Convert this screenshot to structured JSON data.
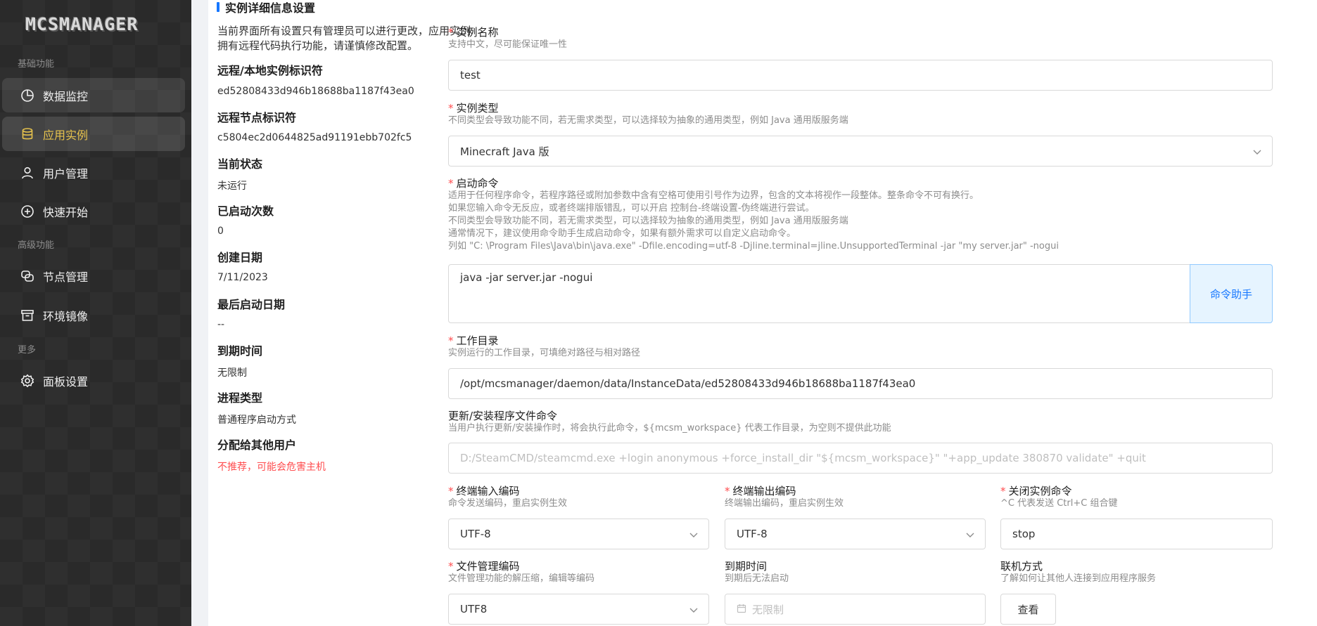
{
  "sidebar": {
    "logo": "MCSMANAGER",
    "sections": {
      "basic": "基础功能",
      "advanced": "高级功能",
      "more": "更多"
    },
    "items": [
      {
        "label": "数据监控",
        "icon": "dashboard-icon"
      },
      {
        "label": "应用实例",
        "icon": "database-icon"
      },
      {
        "label": "用户管理",
        "icon": "user-icon"
      },
      {
        "label": "快速开始",
        "icon": "plus-circle-icon"
      },
      {
        "label": "节点管理",
        "icon": "node-icon"
      },
      {
        "label": "环境镜像",
        "icon": "image-icon"
      },
      {
        "label": "面板设置",
        "icon": "gear-icon"
      }
    ],
    "accent": "#e7c34d"
  },
  "page": {
    "title": "实例详细信息设置",
    "notice": "当前界面所有设置只有管理员可以进行更改，应用实例拥有远程代码执行功能，请谨慎修改配置。",
    "info": [
      {
        "label": "远程/本地实例标识符",
        "value": "ed52808433d946b18688ba1187f43ea0"
      },
      {
        "label": "远程节点标识符",
        "value": "c5804ec2d0644825ad91191ebb702fc5"
      },
      {
        "label": "当前状态",
        "value": "未运行"
      },
      {
        "label": "已启动次数",
        "value": "0"
      },
      {
        "label": "创建日期",
        "value": "7/11/2023"
      },
      {
        "label": "最后启动日期",
        "value": "--"
      },
      {
        "label": "到期时间",
        "value": "无限制"
      },
      {
        "label": "进程类型",
        "value": "普通程序启动方式"
      },
      {
        "label": "分配给其他用户",
        "value": "不推荐，可能会危害主机"
      }
    ]
  },
  "form": {
    "name": {
      "label": "实例名称",
      "hint": "支持中文，尽可能保证唯一性",
      "value": "test"
    },
    "type": {
      "label": "实例类型",
      "hint": "不同类型会导致功能不同，若无需求类型，可以选择较为抽象的通用类型，例如 Java 通用版服务端",
      "value": "Minecraft Java 版"
    },
    "command": {
      "label": "启动命令",
      "hints": [
        "适用于任何程序命令，若程序路径或附加参数中含有空格可使用引号作为边界，包含的文本将视作一段整体。整条命令不可有换行。",
        "如果您输入命令无反应，或者终端排版错乱，可以开启 控制台-终端设置-伪终端进行尝试。",
        "不同类型会导致功能不同，若无需求类型，可以选择较为抽象的通用类型，例如 Java 通用版服务端",
        "通常情况下，建议使用命令助手生成启动命令，如果有额外需求可以自定义启动命令。",
        "列如 \"C: \\Program Files\\Java\\bin\\java.exe\" -Dfile.encoding=utf-8 -Djline.terminal=jline.UnsupportedTerminal -jar \"my server.jar\" -nogui"
      ],
      "value": "java -jar server.jar -nogui",
      "helper": "命令助手"
    },
    "cwd": {
      "label": "工作目录",
      "hint": "实例运行的工作目录，可填绝对路径与相对路径",
      "value": "/opt/mcsmanager/daemon/data/InstanceData/ed52808433d946b18688ba1187f43ea0"
    },
    "update": {
      "label": "更新/安装程序文件命令",
      "hint": "当用户执行更新/安装操作时，将会执行此命令，${mcsm_workspace} 代表工作目录，为空则不提供此功能",
      "placeholder": "D:/SteamCMD/steamcmd.exe +login anonymous +force_install_dir \"${mcsm_workspace}\" \"+app_update 380870 validate\" +quit"
    },
    "in_enc": {
      "label": "终端输入编码",
      "hint": "命令发送编码，重启实例生效",
      "value": "UTF-8"
    },
    "out_enc": {
      "label": "终端输出编码",
      "hint": "终端输出编码，重启实例生效",
      "value": "UTF-8"
    },
    "stop": {
      "label": "关闭实例命令",
      "hint": "^C 代表发送 Ctrl+C 组合键",
      "value": "stop"
    },
    "file_enc": {
      "label": "文件管理编码",
      "hint": "文件管理功能的解压缩，编辑等编码",
      "value": "UTF8"
    },
    "expire": {
      "label": "到期时间",
      "hint": "到期后无法启动",
      "placeholder": "无限制"
    },
    "connect": {
      "label": "联机方式",
      "hint": "了解如何让其他人连接到应用程序服务",
      "button": "查看"
    }
  }
}
